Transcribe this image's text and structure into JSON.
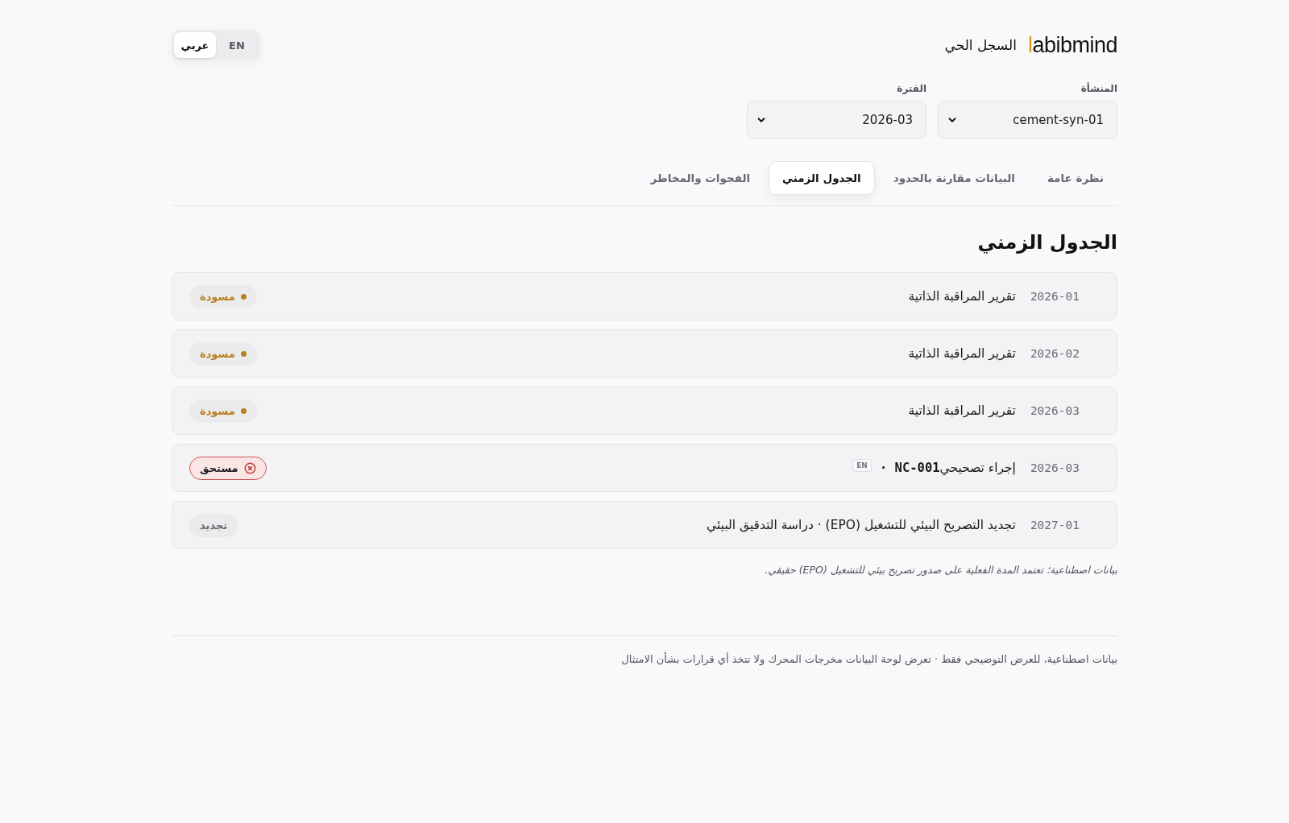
{
  "header": {
    "brand": "labibmind",
    "title": "السجل الحي",
    "languages": [
      {
        "label": "EN",
        "selected": false
      },
      {
        "label": "عربي",
        "selected": true
      }
    ]
  },
  "filters": [
    {
      "label": "المنشأة",
      "value": "cement-syn-01"
    },
    {
      "label": "الفترة",
      "value": "2026-03"
    }
  ],
  "tabs": [
    {
      "label": "نظرة عامة",
      "selected": false
    },
    {
      "label": "البيانات مقارنة بالحدود",
      "selected": false
    },
    {
      "label": "الجدول الزمني",
      "selected": true
    },
    {
      "label": "الفجوات والمخاطر",
      "selected": false
    }
  ],
  "timeline": {
    "title": "الجدول الزمني",
    "events": [
      {
        "date": "2026-01",
        "title": "تقرير المراقبة الذاتية",
        "status": {
          "kind": "draft",
          "label": "مسودة"
        }
      },
      {
        "date": "2026-02",
        "title": "تقرير المراقبة الذاتية",
        "status": {
          "kind": "draft",
          "label": "مسودة"
        }
      },
      {
        "date": "2026-03",
        "title": "تقرير المراقبة الذاتية",
        "status": {
          "kind": "draft",
          "label": "مسودة"
        }
      },
      {
        "date": "2026-03",
        "title": "إجراء تصحيحي",
        "code": "NC-001 ·",
        "lang": "EN",
        "status": {
          "kind": "overdue",
          "label": "مستحق"
        }
      },
      {
        "date": "2027-01",
        "title": "تجديد التصريح البيئي للتشغيل (EPO) · دراسة التدقيق البيئي",
        "status": {
          "kind": "renewal",
          "label": "تجديد"
        }
      }
    ],
    "note": "بيانات اصطناعية؛ تعتمد المدة الفعلية على صدور تصريح بيئي للتشغيل (EPO) حقيقي."
  },
  "footer": "بيانات اصطناعية، للعرض التوضيحي فقط · تعرض لوحة البيانات مخرجات المحرك ولا تتخذ أي قرارات بشأن الامتثال"
}
